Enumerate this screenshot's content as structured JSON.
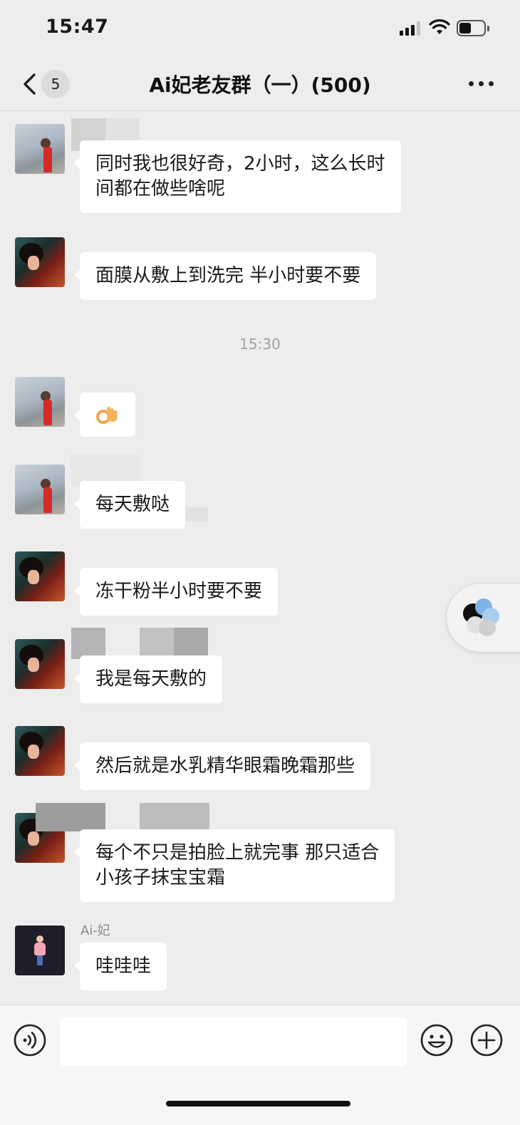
{
  "status_bar": {
    "time": "15:47",
    "signal_icon": "signal-bars-icon",
    "wifi_icon": "wifi-icon",
    "battery_icon": "battery-icon"
  },
  "nav": {
    "back_icon": "chevron-left-icon",
    "unread_count": "5",
    "title": "Ai妃老友群（一）(500)",
    "more_icon": "more-dots-icon"
  },
  "messages": [
    {
      "avatar": "avatar-woman-red-dress",
      "lines": [
        "同时我也很好奇，2小时，这么长时",
        "间都在做些啥呢"
      ]
    },
    {
      "avatar": "avatar-woman-fan",
      "lines": [
        "面膜从敷上到洗完 半小时要不要"
      ]
    },
    {
      "avatar": "avatar-woman-red-dress",
      "emoji": "ok-hand-emoji"
    },
    {
      "avatar": "avatar-woman-red-dress",
      "lines": [
        "每天敷哒"
      ]
    },
    {
      "avatar": "avatar-woman-fan",
      "lines": [
        "冻干粉半小时要不要"
      ]
    },
    {
      "avatar": "avatar-woman-fan",
      "lines": [
        "我是每天敷的"
      ]
    },
    {
      "avatar": "avatar-woman-fan",
      "lines": [
        "然后就是水乳精华眼霜晚霜那些"
      ]
    },
    {
      "avatar": "avatar-woman-fan",
      "lines": [
        "每个不只是拍脸上就完事 那只适合",
        "小孩子抹宝宝霜"
      ]
    },
    {
      "avatar": "avatar-cartoon-figure",
      "sender": "Ai-妃",
      "lines": [
        "哇哇哇"
      ]
    }
  ],
  "time_divider": "15:30",
  "floating_tab_icon": "mini-program-float-icon",
  "input_bar": {
    "voice_icon": "voice-icon",
    "input_value": "",
    "emoji_icon": "emoji-smile-icon",
    "plus_icon": "plus-circle-icon"
  },
  "colors": {
    "background": "#ededed",
    "bubble": "#ffffff",
    "text": "#1a1a1a",
    "timestamp": "#a3a3a3"
  }
}
